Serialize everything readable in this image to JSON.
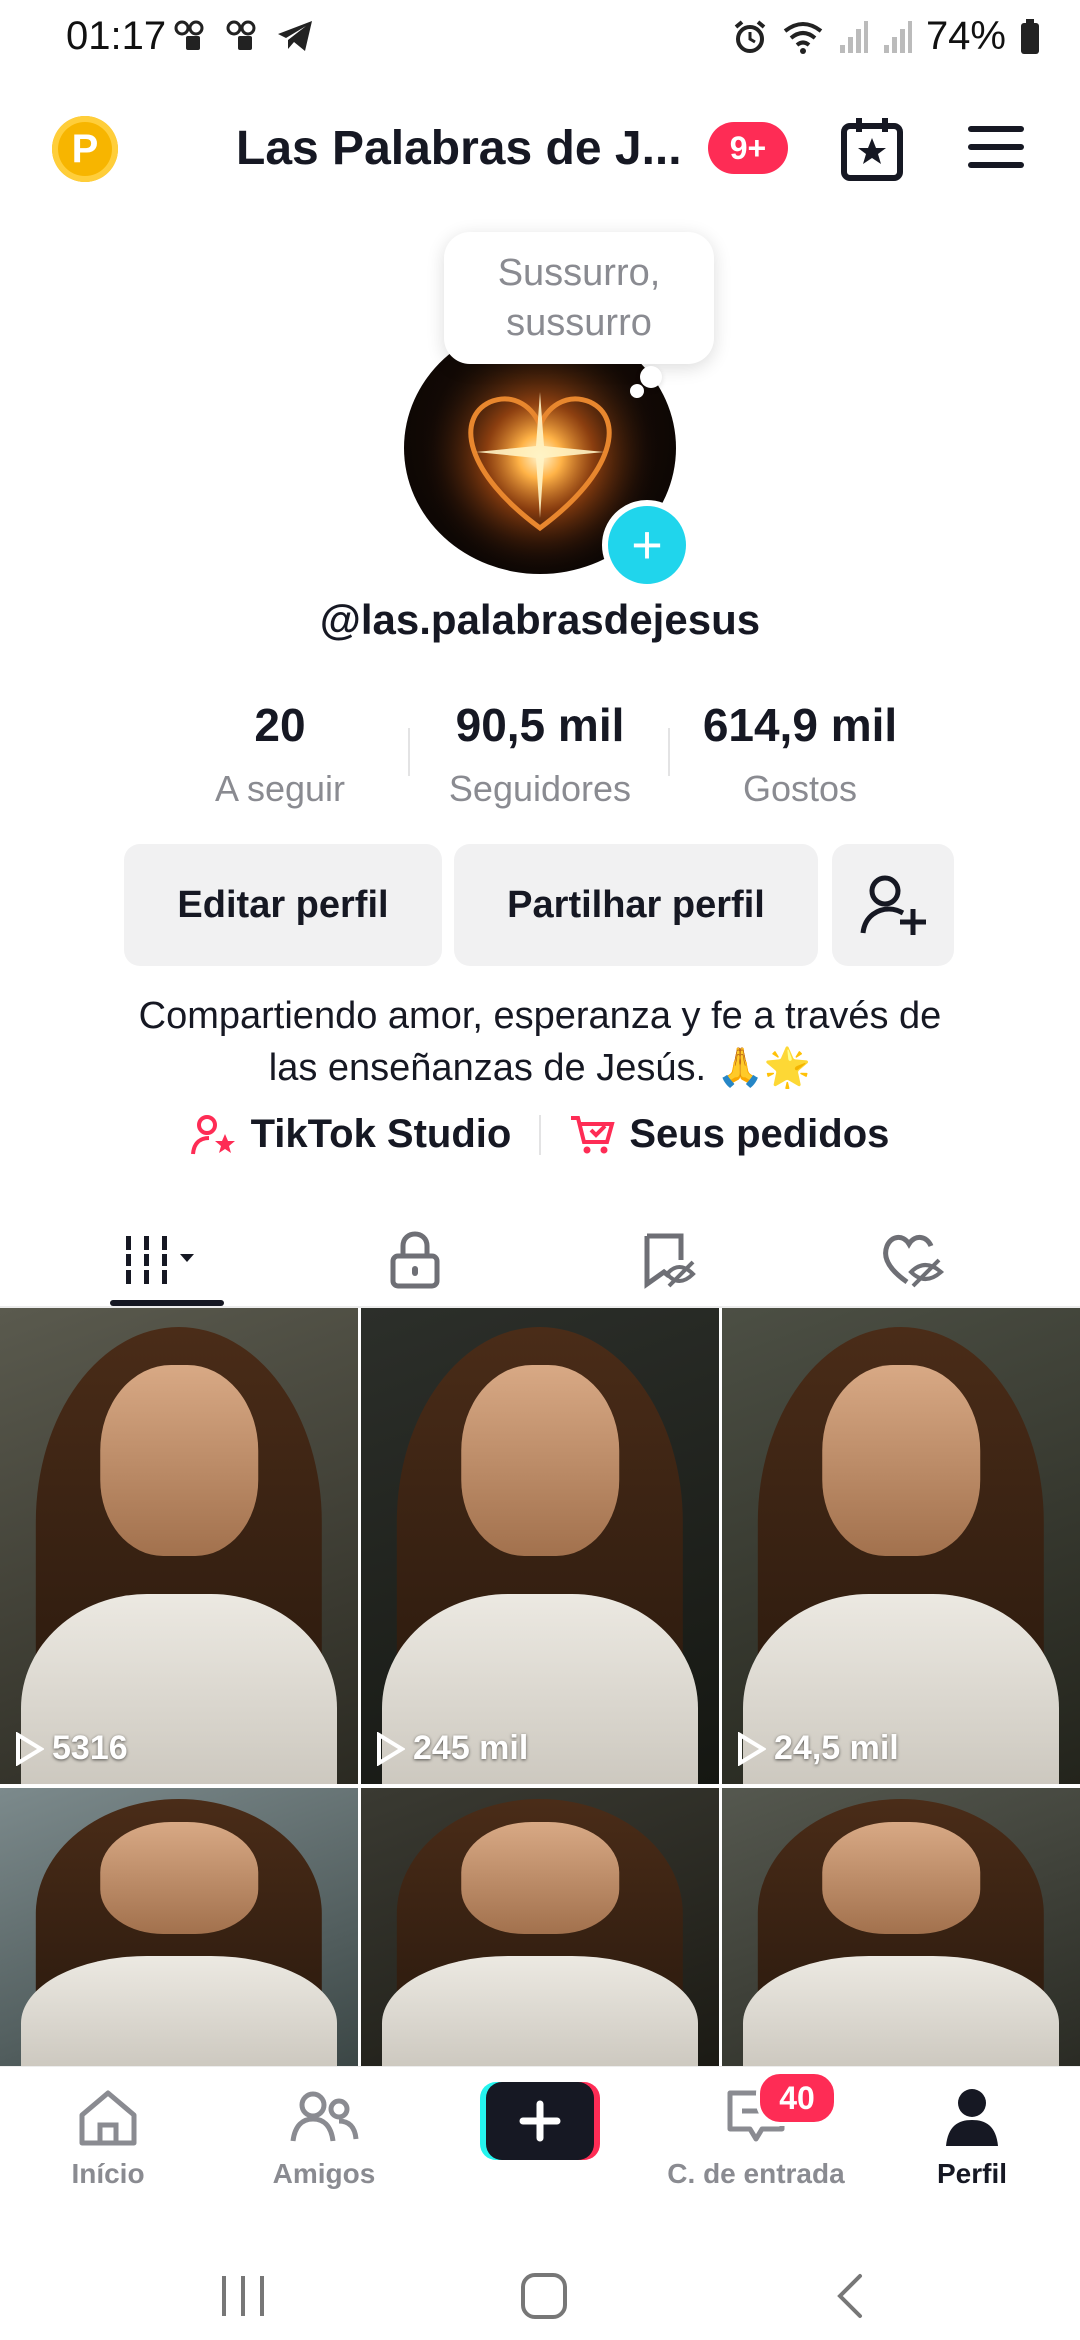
{
  "status_bar": {
    "time": "01:17",
    "battery": "74%",
    "icons": [
      "voicemail-icon",
      "voicemail-icon",
      "telegram-icon",
      "alarm-icon",
      "wifi-icon",
      "signal-icon",
      "signal-icon",
      "battery-icon"
    ]
  },
  "header": {
    "coin_letter": "P",
    "title": "Las Palabras de J...",
    "notif_badge": "9+",
    "icons": [
      "calendar-star-icon",
      "menu-icon"
    ]
  },
  "profile": {
    "bubble_text": "Sussurro, sussurro",
    "username": "@las.palabrasdejesus",
    "stats": [
      {
        "value": "20",
        "label": "A seguir"
      },
      {
        "value": "90,5 mil",
        "label": "Seguidores"
      },
      {
        "value": "614,9 mil",
        "label": "Gostos"
      }
    ],
    "buttons": {
      "edit": "Editar perfil",
      "share": "Partilhar perfil"
    },
    "bio_line1": "Compartiendo amor, esperanza y fe a través de",
    "bio_line2": "las enseñanzas de Jesús. 🙏🌟",
    "links": {
      "studio": "TikTok Studio",
      "orders": "Seus pedidos"
    }
  },
  "tabs": [
    "videos-grid-icon",
    "lock-icon",
    "saved-hidden-icon",
    "liked-hidden-icon"
  ],
  "grid": [
    {
      "views": "5316"
    },
    {
      "views": "245 mil"
    },
    {
      "views": "24,5 mil"
    },
    {
      "views": ""
    },
    {
      "views": ""
    },
    {
      "views": ""
    }
  ],
  "bottom_nav": {
    "home": "Início",
    "friends": "Amigos",
    "inbox": "C. de entrada",
    "profile": "Perfil",
    "inbox_badge": "40"
  },
  "colors": {
    "accent_red": "#fe2c55",
    "accent_cyan": "#20d5ec",
    "coin": "#f7b500",
    "text": "#161823",
    "secondary": "#8a8b91"
  }
}
